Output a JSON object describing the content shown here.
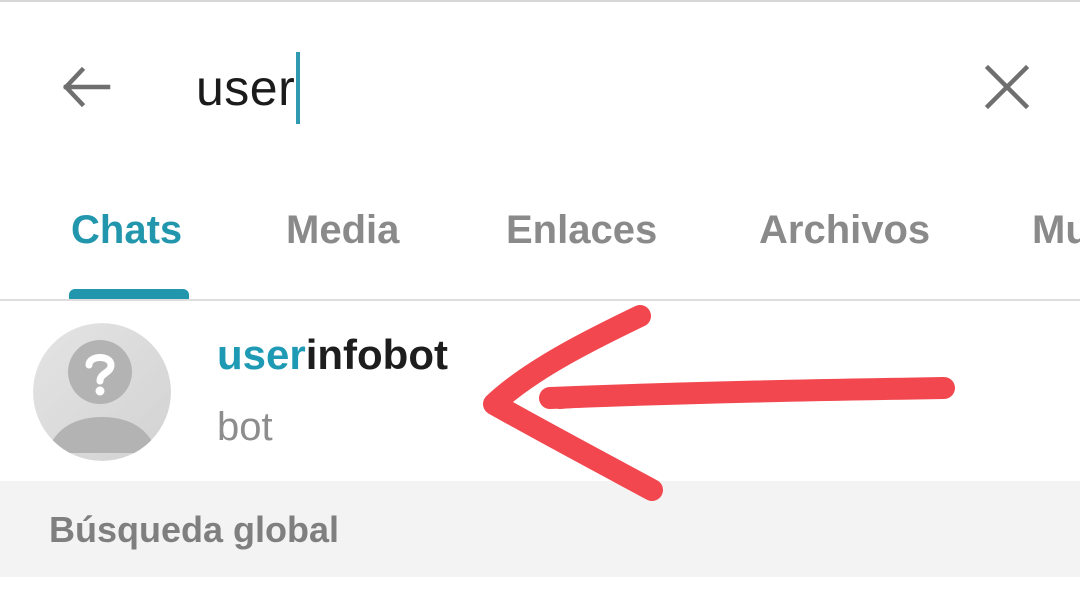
{
  "search": {
    "query": "user",
    "back_icon": "arrow-left-icon",
    "clear_icon": "close-icon",
    "caret_color": "#2f9ab1"
  },
  "tabs": [
    {
      "label": "Chats",
      "active": true
    },
    {
      "label": "Media",
      "active": false
    },
    {
      "label": "Enlaces",
      "active": false
    },
    {
      "label": "Archivos",
      "active": false
    },
    {
      "label": "Mu",
      "active": false
    }
  ],
  "results": [
    {
      "name_highlight": "user",
      "name_rest": "infobot",
      "subtitle": "bot",
      "avatar_icon": "unknown-user-icon"
    }
  ],
  "global_search": {
    "label": "Búsqueda global"
  },
  "annotation": {
    "icon": "red-arrow-icon",
    "color": "#f2474f"
  },
  "colors": {
    "accent": "#2196ad",
    "highlight": "#1e9ab5",
    "tab_inactive": "#8a8a8a",
    "section_bg": "#f3f3f3"
  }
}
